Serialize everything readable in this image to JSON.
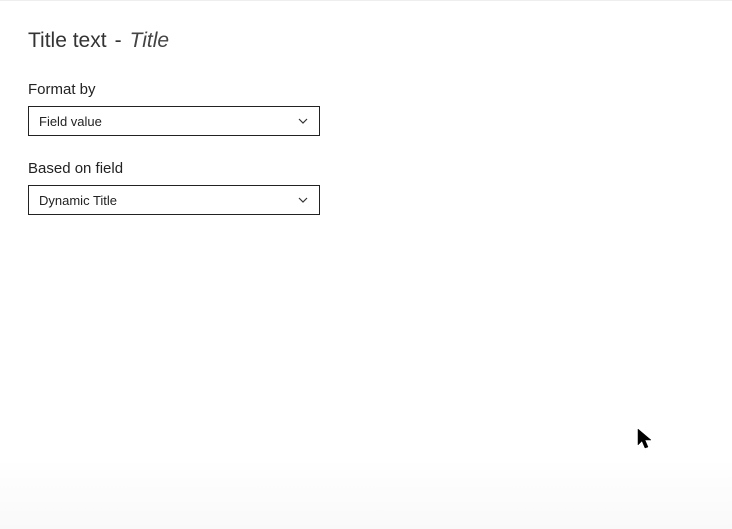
{
  "header": {
    "prefix": "Title text",
    "separator": "-",
    "title": "Title"
  },
  "fields": {
    "formatBy": {
      "label": "Format by",
      "value": "Field value"
    },
    "basedOnField": {
      "label": "Based on field",
      "value": "Dynamic Title"
    }
  }
}
